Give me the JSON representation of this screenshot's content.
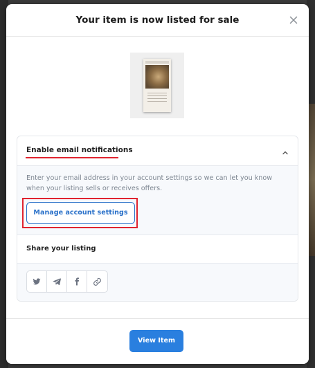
{
  "modal": {
    "title": "Your item is now listed for sale",
    "close_icon": "close-icon"
  },
  "item": {
    "thumbnail_icon": "book-cover-image"
  },
  "email_section": {
    "heading": "Enable email notifications",
    "expanded": true,
    "description": "Enter your email address in your account settings so we can let you know when your listing sells or receives offers.",
    "button_label": "Manage account settings"
  },
  "share_section": {
    "heading": "Share your listing",
    "buttons": [
      "twitter-icon",
      "telegram-icon",
      "facebook-icon",
      "link-icon"
    ]
  },
  "footer": {
    "button_label": "View Item"
  },
  "colors": {
    "accent": "#2a7fdf",
    "annotation": "#e0232f"
  }
}
